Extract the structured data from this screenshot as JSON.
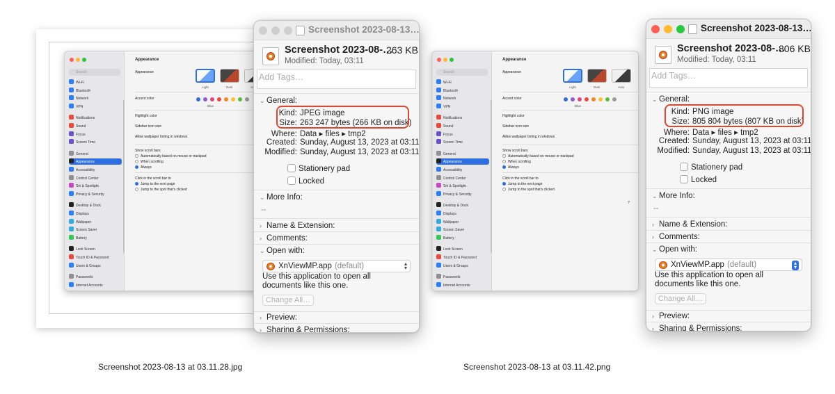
{
  "left": {
    "caption": "Screenshot 2023-08-13 at 03.11.28.jpg",
    "info": {
      "title": "Screenshot 2023-08-13…",
      "name": "Screenshot 2023-08-…",
      "size": "263 KB",
      "modified": "Modified: Today, 03:11",
      "tags_placeholder": "Add Tags…",
      "general": "General:",
      "kind_k": "Kind:",
      "kind_v": "JPEG image",
      "size_k": "Size:",
      "size_v": "263 247 bytes (266 KB on disk)",
      "where_k": "Where:",
      "where_v": "Data ▸ files ▸ tmp2",
      "created_k": "Created:",
      "created_v": "Sunday, August 13, 2023 at 03:11",
      "modified_k": "Modified:",
      "modified_v": "Sunday, August 13, 2023 at 03:11",
      "stationery": "Stationery pad",
      "locked": "Locked",
      "more_info": "More Info:",
      "more_info_v": "--",
      "name_ext": "Name & Extension:",
      "comments": "Comments:",
      "open_with": "Open with:",
      "app": "XnViewMP.app",
      "app_default": "(default)",
      "open_desc": "Use this application to open all documents like this one.",
      "change_all": "Change All…",
      "preview": "Preview:",
      "sharing": "Sharing & Permissions:"
    }
  },
  "right": {
    "caption": "Screenshot 2023-08-13 at 03.11.42.png",
    "info": {
      "title": "Screenshot 2023-08-13…",
      "name": "Screenshot 2023-08-…",
      "size": "806 KB",
      "modified": "Modified: Today, 03:11",
      "tags_placeholder": "Add Tags…",
      "general": "General:",
      "kind_k": "Kind:",
      "kind_v": "PNG image",
      "size_k": "Size:",
      "size_v": "805 804 bytes (807 KB on disk)",
      "where_k": "Where:",
      "where_v": "Data ▸ files ▸ tmp2",
      "created_k": "Created:",
      "created_v": "Sunday, August 13, 2023 at 03:11",
      "modified_k": "Modified:",
      "modified_v": "Sunday, August 13, 2023 at 03:11",
      "stationery": "Stationery pad",
      "locked": "Locked",
      "more_info": "More Info:",
      "more_info_v": "--",
      "name_ext": "Name & Extension:",
      "comments": "Comments:",
      "open_with": "Open with:",
      "app": "XnViewMP.app",
      "app_default": "(default)",
      "open_desc": "Use this application to open all documents like this one.",
      "change_all": "Change All…",
      "preview": "Preview:",
      "sharing": "Sharing & Permissions:"
    }
  },
  "mini": {
    "search": "Search",
    "sidebar": [
      "Wi-Fi",
      "Bluetooth",
      "Network",
      "VPN",
      "Notifications",
      "Sound",
      "Focus",
      "Screen Time",
      "General",
      "Appearance",
      "Accessibility",
      "Control Center",
      "Siri & Spotlight",
      "Privacy & Security",
      "Desktop & Dock",
      "Displays",
      "Wallpaper",
      "Screen Saver",
      "Battery",
      "Lock Screen",
      "Touch ID & Password",
      "Users & Groups",
      "Passwords",
      "Internet Accounts"
    ],
    "title": "Appearance",
    "appearance": "Appearance",
    "light": "Light",
    "dark": "Dark",
    "auto": "Auto",
    "accent": "Accent color",
    "blue": "Blue",
    "highlight": "Highlight color",
    "highlight_v": "Blue",
    "sidebar_icon": "Sidebar icon size",
    "sidebar_icon_v": "Medium",
    "tinting": "Allow wallpaper tinting in windows",
    "show_scroll": "Show scroll bars",
    "auto_scroll": "Automatically based on mouse or trackpad",
    "when_scroll": "When scrolling",
    "always": "Always",
    "click_scroll": "Click in the scroll bar to",
    "jump_next": "Jump to the next page",
    "jump_spot": "Jump to the spot that's clicked",
    "help": "?"
  },
  "colors": {
    "highlight_ring": "#e0452e",
    "accent": "#2d6fe0",
    "traffic": [
      "#ff5f57",
      "#febc2e",
      "#28c840"
    ]
  }
}
